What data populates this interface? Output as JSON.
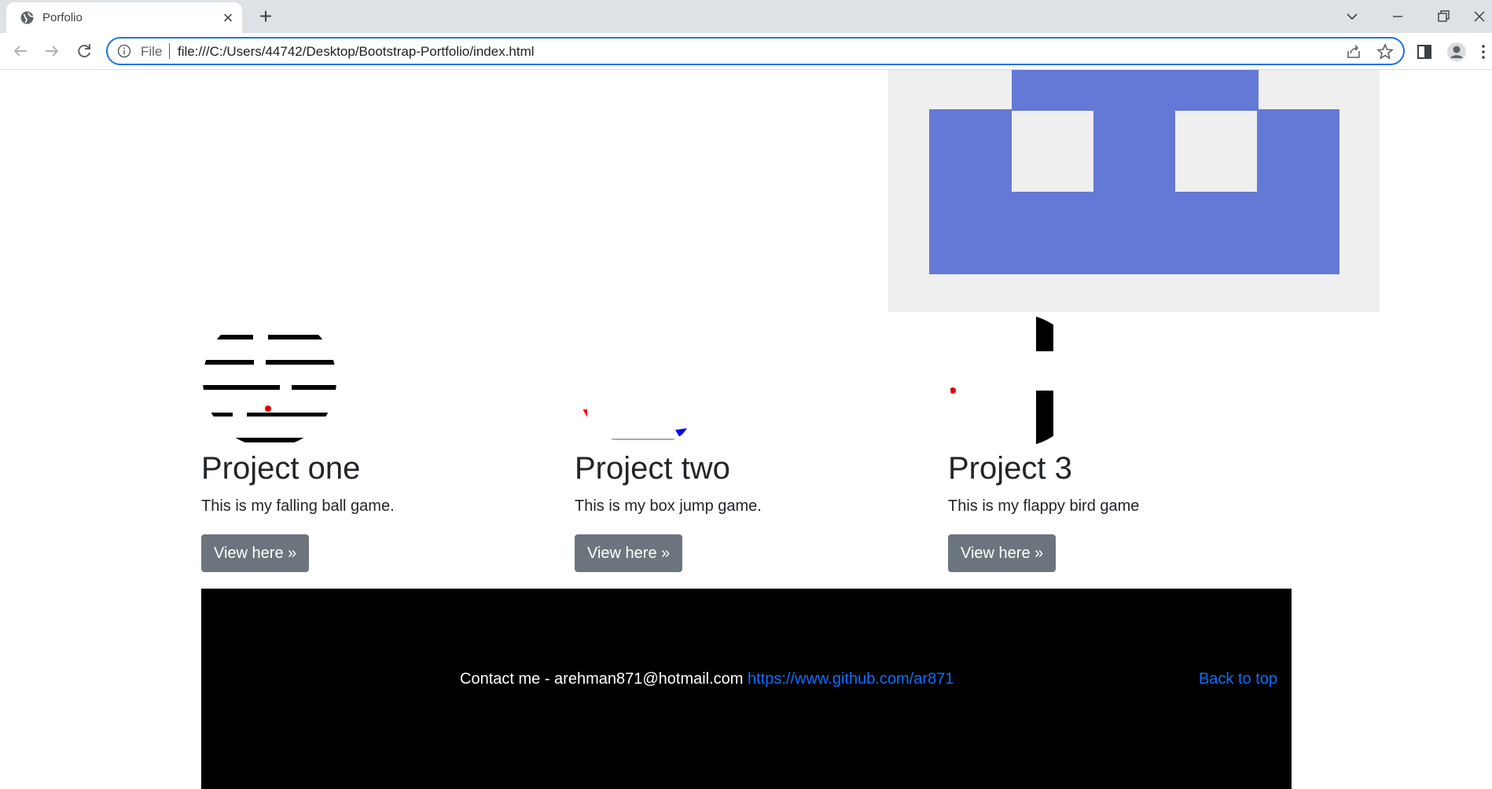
{
  "browser": {
    "tab_title": "Porfolio",
    "omnibox_scheme": "File",
    "url": "file:///C:/Users/44742/Desktop/Bootstrap-Portfolio/index.html"
  },
  "projects": [
    {
      "title": "Project one",
      "description": "This is my falling ball game.",
      "button": "View here »"
    },
    {
      "title": "Project two",
      "description": "This is my box jump game.",
      "button": "View here »"
    },
    {
      "title": "Project 3",
      "description": "This is my flappy bird game",
      "button": "View here »"
    }
  ],
  "footer": {
    "contact_text": "Contact me - arehman871@hotmail.com ",
    "github_link": "https://www.github.com/ar871",
    "back_to_top": "Back to top"
  },
  "colors": {
    "hero_blue": "#6479d6",
    "hero_bg": "#efefef",
    "button_gray": "#6c757d",
    "link_blue": "#0d6efd",
    "footer_bg": "#000000"
  }
}
